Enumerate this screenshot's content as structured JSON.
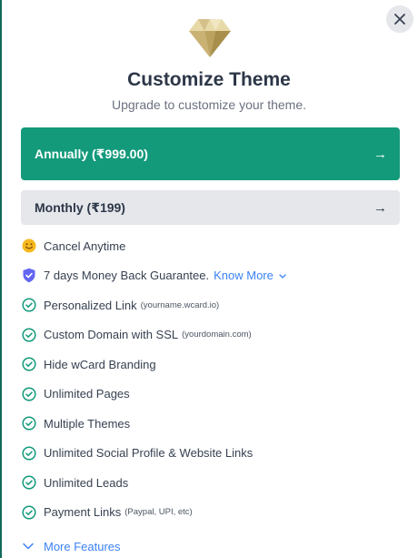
{
  "dialog": {
    "title": "Customize Theme",
    "subtitle": "Upgrade to customize your theme.",
    "close_icon": "close-icon",
    "header_icon": "diamond-icon"
  },
  "plans": [
    {
      "label": "Annually (₹999.00)",
      "arrow": "→",
      "selected": true
    },
    {
      "label": "Monthly (₹199)",
      "arrow": "→",
      "selected": false
    }
  ],
  "features": [
    {
      "icon": "smiley-icon",
      "text": "Cancel Anytime"
    },
    {
      "icon": "shield-check-icon",
      "text": "7 days Money Back Guarantee.",
      "link": "Know More"
    },
    {
      "icon": "check-circle-icon",
      "text": "Personalized Link",
      "note": "(yourname.wcard.io)"
    },
    {
      "icon": "check-circle-icon",
      "text": "Custom Domain with SSL",
      "note": "(yourdomain.com)"
    },
    {
      "icon": "check-circle-icon",
      "text": "Hide wCard Branding"
    },
    {
      "icon": "check-circle-icon",
      "text": "Unlimited Pages"
    },
    {
      "icon": "check-circle-icon",
      "text": "Multiple Themes"
    },
    {
      "icon": "check-circle-icon",
      "text": "Unlimited Social Profile & Website Links"
    },
    {
      "icon": "check-circle-icon",
      "text": "Unlimited Leads"
    },
    {
      "icon": "check-circle-icon",
      "text": "Payment Links",
      "note": "(Paypal, UPI, etc)"
    }
  ],
  "more_features": {
    "label": "More Features"
  },
  "colors": {
    "primary": "#139a7b",
    "secondary_bg": "#e5e7eb",
    "link": "#3b82f6",
    "check": "#139a7b",
    "shield": "#6366f1",
    "smiley": "#f5b81f"
  }
}
